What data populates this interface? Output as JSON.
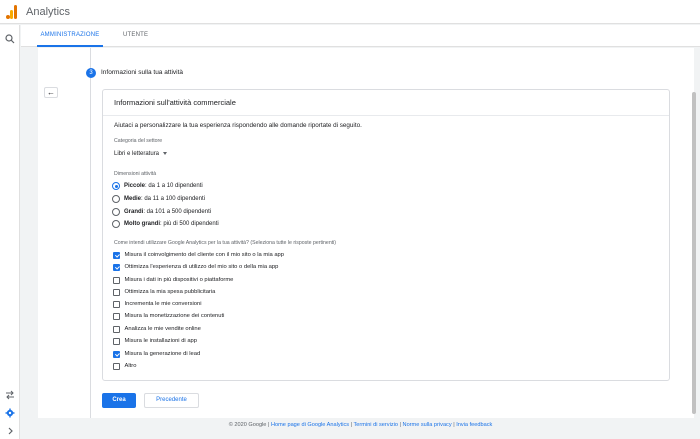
{
  "app": {
    "title": "Analytics",
    "icon": "analytics-logo-icon"
  },
  "rail": {
    "search_icon": "search-icon",
    "shortcuts_icon": "swap-icon",
    "admin_icon": "gear-icon",
    "expand_icon": "chevron-right-icon"
  },
  "tabs": [
    {
      "label": "AMMINISTRAZIONE",
      "active": true
    },
    {
      "label": "UTENTE",
      "active": false
    }
  ],
  "step": {
    "number": "3",
    "title": "Informazioni sulla tua attività"
  },
  "card": {
    "title": "Informazioni sull'attività commerciale",
    "intro": "Aiutaci a personalizzare la tua esperienza rispondendo alle domande riportate di seguito.",
    "category_label": "Categoria del settore",
    "category_value": "Libri e letteratura",
    "size_label": "Dimensioni attività",
    "sizes": [
      {
        "name": "Piccole",
        "desc": ": da 1 a 10 dipendenti",
        "checked": true
      },
      {
        "name": "Medie",
        "desc": ": da 11 a 100 dipendenti",
        "checked": false
      },
      {
        "name": "Grandi",
        "desc": ": da 101 a 500 dipendenti",
        "checked": false
      },
      {
        "name": "Molto grandi",
        "desc": ": più di 500 dipendenti",
        "checked": false
      }
    ],
    "usage_label": "Come intendi utilizzare Google Analytics per la tua attività? (Seleziona tutte le risposte pertinenti)",
    "usages": [
      {
        "label": "Misura il coinvolgimento del cliente con il mio sito o la mia app",
        "checked": true
      },
      {
        "label": "Ottimizza l'esperienza di utilizzo del mio sito o della mia app",
        "checked": true
      },
      {
        "label": "Misura i dati in più dispositivi o piattaforme",
        "checked": false
      },
      {
        "label": "Ottimizza la mia spesa pubblicitaria",
        "checked": false
      },
      {
        "label": "Incrementa le mie conversioni",
        "checked": false
      },
      {
        "label": "Misura la monetizzazione dei contenuti",
        "checked": false
      },
      {
        "label": "Analizza le mie vendite online",
        "checked": false
      },
      {
        "label": "Misura le installazioni di app",
        "checked": false
      },
      {
        "label": "Misura la generazione di lead",
        "checked": true
      },
      {
        "label": "Altro",
        "checked": false
      }
    ]
  },
  "buttons": {
    "create": "Crea",
    "previous": "Precedente"
  },
  "footer": {
    "copyright": "© 2020 Google",
    "links": [
      "Home page di Google Analytics",
      "Termini di servizio",
      "Norme sulla privacy",
      "Invia feedback"
    ]
  },
  "colors": {
    "accent": "#1a73e8",
    "brand": "#e37400"
  }
}
